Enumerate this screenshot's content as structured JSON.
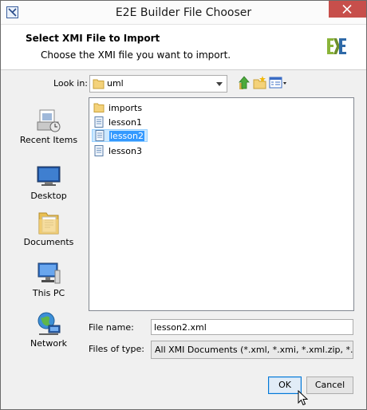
{
  "window": {
    "title": "E2E Builder File Chooser"
  },
  "banner": {
    "heading": "Select XMI File to Import",
    "subheading": "Choose the XMI file you want to import.",
    "logo": "E2E-logo-icon"
  },
  "look_in": {
    "label": "Look in:",
    "value": "uml"
  },
  "toolbar": {
    "up_icon": "up-one-level-icon",
    "new_folder_icon": "create-new-folder-icon",
    "view_icon": "view-menu-icon"
  },
  "places": [
    {
      "label": "Recent Items",
      "icon": "recent-items-icon"
    },
    {
      "label": "Desktop",
      "icon": "desktop-icon"
    },
    {
      "label": "Documents",
      "icon": "documents-icon"
    },
    {
      "label": "This PC",
      "icon": "this-pc-icon"
    },
    {
      "label": "Network",
      "icon": "network-icon"
    }
  ],
  "files": [
    {
      "name": "imports",
      "type": "folder",
      "selected": false
    },
    {
      "name": "lesson1",
      "type": "file",
      "selected": false
    },
    {
      "name": "lesson2",
      "type": "file",
      "selected": true
    },
    {
      "name": "lesson3",
      "type": "file",
      "selected": false
    }
  ],
  "file_name": {
    "label": "File name:",
    "value": "lesson2.xml"
  },
  "file_type": {
    "label": "Files of type:",
    "value": "All XMI Documents (*.xml, *.xmi, *.xml.zip, *.mdzip)"
  },
  "buttons": {
    "ok": "OK",
    "cancel": "Cancel"
  },
  "colors": {
    "accent": "#0078d7",
    "selection": "#3399ff",
    "close": "#c74f4b"
  }
}
